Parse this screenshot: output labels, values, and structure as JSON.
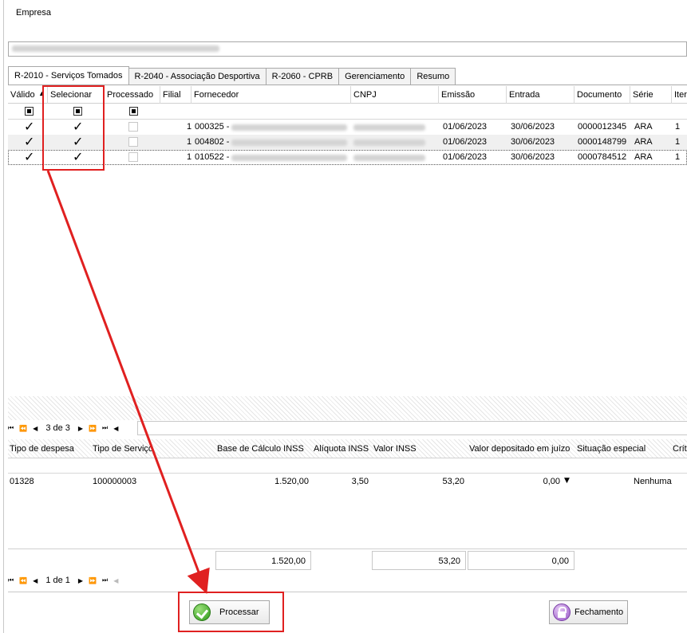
{
  "empresa": {
    "label": "Empresa",
    "value": "001 - COMBUSTRAN DERIVADOS DE PETROLEO LTDA"
  },
  "tabs": [
    {
      "label": "R-2010 - Serviços Tomados",
      "active": true
    },
    {
      "label": "R-2040 - Associação Desportiva"
    },
    {
      "label": "R-2060 - CPRB"
    },
    {
      "label": "Gerenciamento"
    },
    {
      "label": "Resumo"
    }
  ],
  "grid": {
    "headers": [
      "Válido",
      "Selecionar",
      "Processado",
      "Filial",
      "Fornecedor",
      "CNPJ",
      "Emissão",
      "Entrada",
      "Documento",
      "Série",
      "Iter"
    ],
    "rows": [
      {
        "filial": "1",
        "fornecedor_code": "000325 -",
        "fornecedor_name": "XXXXXXXX TECNOLOGI...",
        "cnpj": "00000000000000",
        "emissao": "01/06/2023",
        "entrada": "30/06/2023",
        "documento": "0000012345",
        "serie": "ARA",
        "item": "1"
      },
      {
        "filial": "1",
        "fornecedor_code": "004802 -",
        "fornecedor_name": "XXXXXXXX AUTOPECAS LTDA",
        "cnpj": "00000000000000",
        "emissao": "01/06/2023",
        "entrada": "30/06/2023",
        "documento": "0000148799",
        "serie": "ARA",
        "item": "1"
      },
      {
        "filial": "1",
        "fornecedor_code": "010522 -",
        "fornecedor_name": "XXXXX XXXXXXXXX COMBI...",
        "cnpj": "00000000000000",
        "emissao": "01/06/2023",
        "entrada": "30/06/2023",
        "documento": "0000784512",
        "serie": "ARA",
        "item": "1"
      }
    ],
    "nav_page": "3 de 3"
  },
  "detail": {
    "headers": [
      "Tipo de despesa",
      "Tipo de Serviço",
      "Base de Cálculo INSS",
      "Alíquota INSS",
      "Valor INSS",
      "Valor depositado em juízo",
      "Situação especial",
      "Crít"
    ],
    "row": {
      "tipo_despesa": "01328",
      "tipo_servico": "100000003",
      "base_calculo": "1.520,00",
      "aliquota": "3,50",
      "valor_inss": "53,20",
      "valor_juizo": "0,00",
      "situacao": "Nenhuma"
    },
    "totals": {
      "base_calculo": "1.520,00",
      "valor_inss": "53,20",
      "valor_juizo": "0,00"
    },
    "nav_page": "1 de 1"
  },
  "buttons": {
    "processar": "Processar",
    "fechamento": "Fechamento"
  },
  "colors": {
    "highlight": "#e02020",
    "selected_row": "#f0f0f0"
  }
}
